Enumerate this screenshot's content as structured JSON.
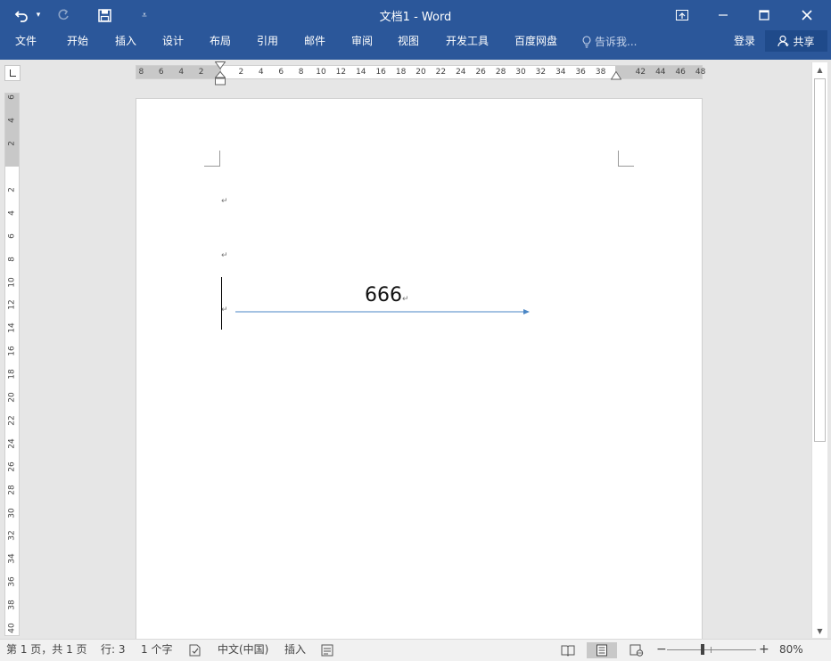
{
  "window": {
    "title": "文档1 - Word"
  },
  "ribbon": {
    "tabs": [
      "文件",
      "开始",
      "插入",
      "设计",
      "布局",
      "引用",
      "邮件",
      "审阅",
      "视图",
      "开发工具",
      "百度网盘"
    ],
    "tell_me_placeholder": "告诉我...",
    "sign_in": "登录",
    "share": "共享"
  },
  "rulers": {
    "horizontal_labels": [
      "8",
      "6",
      "4",
      "2",
      "2",
      "4",
      "6",
      "8",
      "10",
      "12",
      "14",
      "16",
      "18",
      "20",
      "22",
      "24",
      "26",
      "28",
      "30",
      "32",
      "34",
      "36",
      "38",
      "42",
      "44",
      "46",
      "48"
    ],
    "vertical_labels": [
      "6",
      "4",
      "2",
      "2",
      "4",
      "6",
      "8",
      "10",
      "12",
      "14",
      "16",
      "18",
      "20",
      "22",
      "24",
      "26",
      "28",
      "30",
      "32",
      "34",
      "36",
      "38",
      "40"
    ]
  },
  "document": {
    "text": "666"
  },
  "statusbar": {
    "page_info": "第 1 页，共 1 页",
    "line": "行: 3",
    "word_count": "1 个字",
    "language": "中文(中国)",
    "mode": "插入",
    "zoom": "80%"
  }
}
